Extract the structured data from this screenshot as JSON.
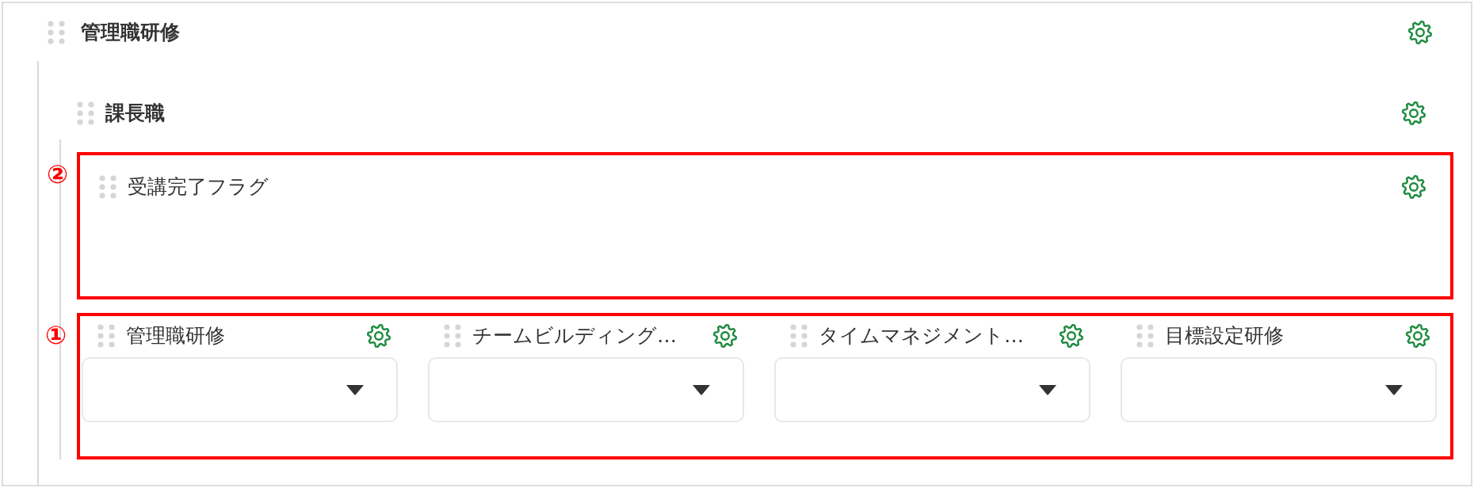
{
  "section": {
    "title": "管理職研修",
    "children": [
      {
        "title": "課長職",
        "children": [
          {
            "kind": "field",
            "annotation": "②",
            "label": "受講完了フラグ"
          },
          {
            "kind": "field-row",
            "annotation": "①",
            "fields": [
              {
                "label": "管理職研修"
              },
              {
                "label": "チームビルディング…"
              },
              {
                "label": "タイムマネジメント…"
              },
              {
                "label": "目標設定研修"
              }
            ]
          }
        ]
      }
    ]
  }
}
